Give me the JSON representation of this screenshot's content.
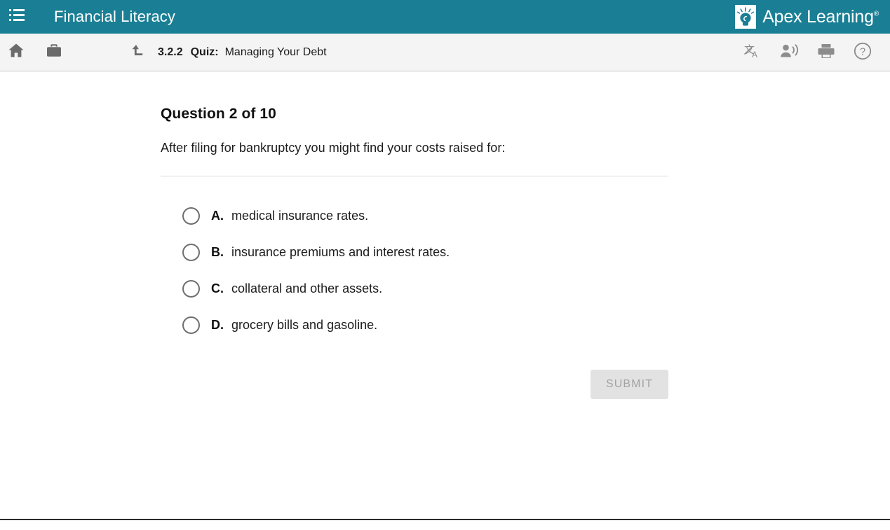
{
  "colors": {
    "header_teal": "#1a7f95",
    "toolbar_bg": "#f4f4f4",
    "toolbar_border": "#c9c9c9",
    "icon_gray": "#6b6b6b",
    "text_dark": "#1c1c1c",
    "divider": "#dcdcdc",
    "radio_border": "#6f6f6f",
    "submit_bg": "#e2e2e2",
    "submit_text": "#a3a3a3",
    "bottom_rule": "#2b2b2b"
  },
  "header": {
    "menu_icon": "list-menu-icon",
    "title": "Financial Literacy",
    "brand": {
      "mark_icon": "apex-lightbulb-logo-icon",
      "name": "Apex Learning",
      "trademark": "®"
    }
  },
  "toolbar": {
    "left_icons": [
      {
        "name": "home-icon",
        "glyph": "home"
      },
      {
        "name": "briefcase-icon",
        "glyph": "briefcase"
      }
    ],
    "up_icon": {
      "name": "level-up-icon",
      "glyph": "arrow-up-corner"
    },
    "breadcrumb": {
      "number": "3.2.2",
      "kind": "Quiz:",
      "name": "Managing Your Debt"
    },
    "right_icons": [
      {
        "name": "translate-icon",
        "glyph": "translate"
      },
      {
        "name": "text-to-speech-icon",
        "glyph": "speaker-person"
      },
      {
        "name": "print-icon",
        "glyph": "printer"
      },
      {
        "name": "help-icon",
        "glyph": "question-circle"
      }
    ]
  },
  "question": {
    "heading": "Question 2 of 10",
    "number": 2,
    "total": 10,
    "prompt": "After filing for bankruptcy you might find your costs raised for:",
    "options": [
      {
        "letter": "A.",
        "text": "medical insurance rates.",
        "selected": false
      },
      {
        "letter": "B.",
        "text": "insurance premiums and interest rates.",
        "selected": false
      },
      {
        "letter": "C.",
        "text": "collateral and other assets.",
        "selected": false
      },
      {
        "letter": "D.",
        "text": "grocery bills and gasoline.",
        "selected": false
      }
    ]
  },
  "submit": {
    "label": "SUBMIT",
    "enabled": false
  }
}
